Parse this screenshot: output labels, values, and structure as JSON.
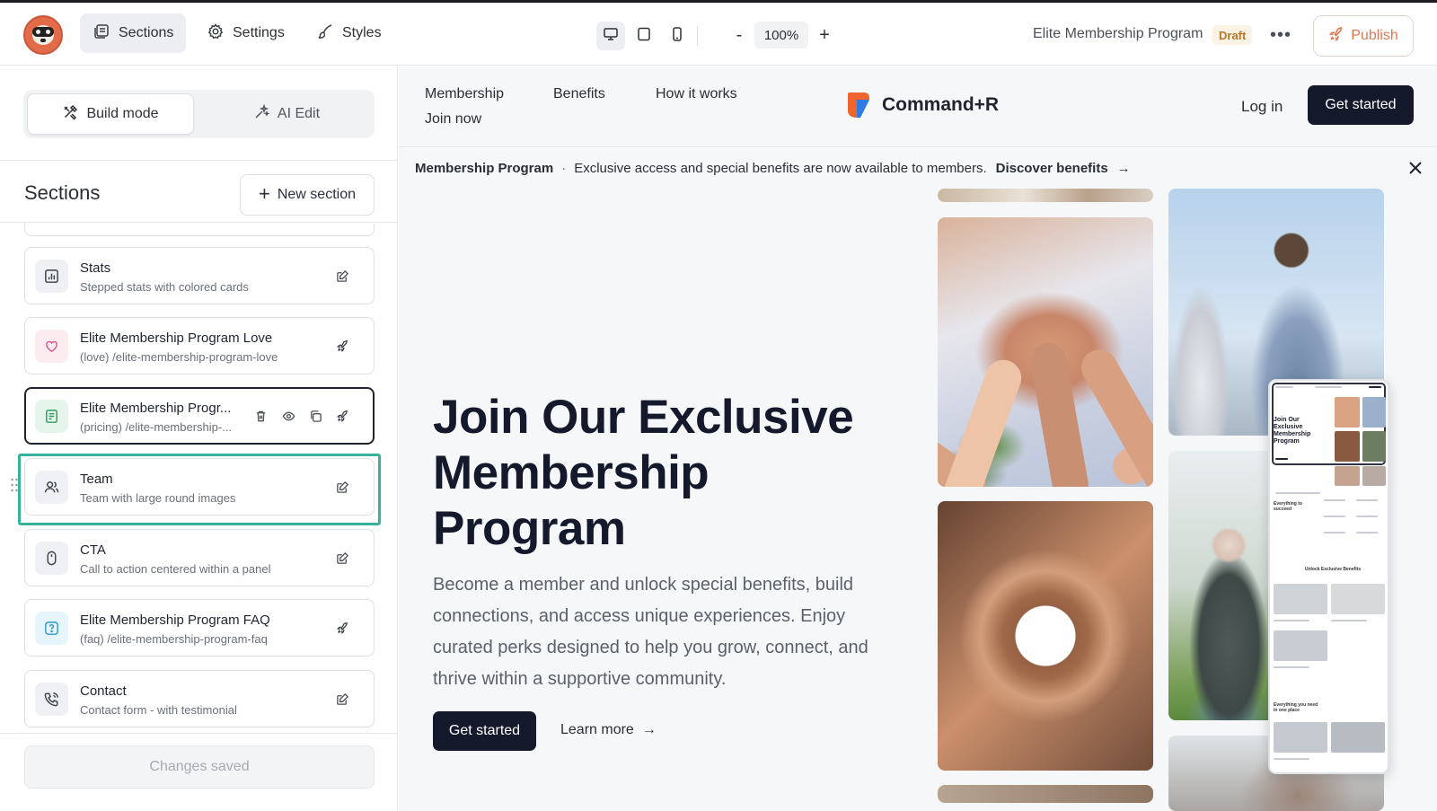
{
  "topbar": {
    "tabs": [
      {
        "label": "Sections",
        "icon": "sections-icon",
        "active": true
      },
      {
        "label": "Settings",
        "icon": "gear-icon",
        "active": false
      },
      {
        "label": "Styles",
        "icon": "brush-icon",
        "active": false
      }
    ],
    "devices": [
      "desktop-icon",
      "tablet-icon",
      "mobile-icon"
    ],
    "zoom": {
      "minus": "-",
      "value": "100%",
      "plus": "+"
    },
    "doc_title": "Elite Membership Program",
    "status_badge": "Draft",
    "more": "•••",
    "publish_label": "Publish",
    "accent_color": "#e2774f"
  },
  "sidebar": {
    "mode": {
      "build_label": "Build mode",
      "ai_label": "AI Edit",
      "active": "build"
    },
    "title": "Sections",
    "new_section_label": "New section",
    "items": [
      {
        "name": "Stats",
        "desc": "Stepped stats with colored cards",
        "icon": "bar-chart-icon",
        "action": "edit"
      },
      {
        "name": "Elite Membership Program Love",
        "desc": "(love) /elite-membership-program-love",
        "icon": "heart-icon",
        "action": "publish"
      },
      {
        "name": "Elite Membership Progr...",
        "desc": "(pricing) /elite-membership-...",
        "icon": "pricing-icon",
        "action": "publish",
        "selected": true
      },
      {
        "name": "Team",
        "desc": "Team with large round images",
        "icon": "users-icon",
        "action": "edit"
      },
      {
        "name": "CTA",
        "desc": "Call to action centered within a panel",
        "icon": "mouse-icon",
        "action": "edit"
      },
      {
        "name": "Elite Membership Program FAQ",
        "desc": "(faq) /elite-membership-program-faq",
        "icon": "help-icon",
        "action": "publish"
      },
      {
        "name": "Contact",
        "desc": "Contact form - with testimonial",
        "icon": "phone-icon",
        "action": "edit"
      }
    ],
    "saved_label": "Changes saved",
    "selection_color": "#36b39a"
  },
  "preview": {
    "nav": {
      "links": [
        "Membership",
        "Benefits",
        "How it works",
        "Join now"
      ],
      "brand": "Command+R",
      "login": "Log in",
      "cta": "Get started"
    },
    "banner": {
      "title": "Membership Program",
      "separator": "·",
      "text": "Exclusive access and special benefits are now available to members.",
      "link": "Discover benefits",
      "arrow": "→"
    },
    "hero": {
      "title": "Join Our Exclusive Membership Program",
      "text": "Become a member and unlock special benefits, build connections, and access unique experiences. Enjoy curated perks designed to help you grow, connect, and thrive within a supportive community.",
      "primary": "Get started",
      "secondary": "Learn more",
      "secondary_arrow": "→"
    },
    "mini": {
      "title": "Join Our Exclusive Membership Program",
      "section2": "Everything to succeed",
      "section3": "Unlock Exclusive Benefits",
      "section4": "Everything you need in one place"
    }
  }
}
